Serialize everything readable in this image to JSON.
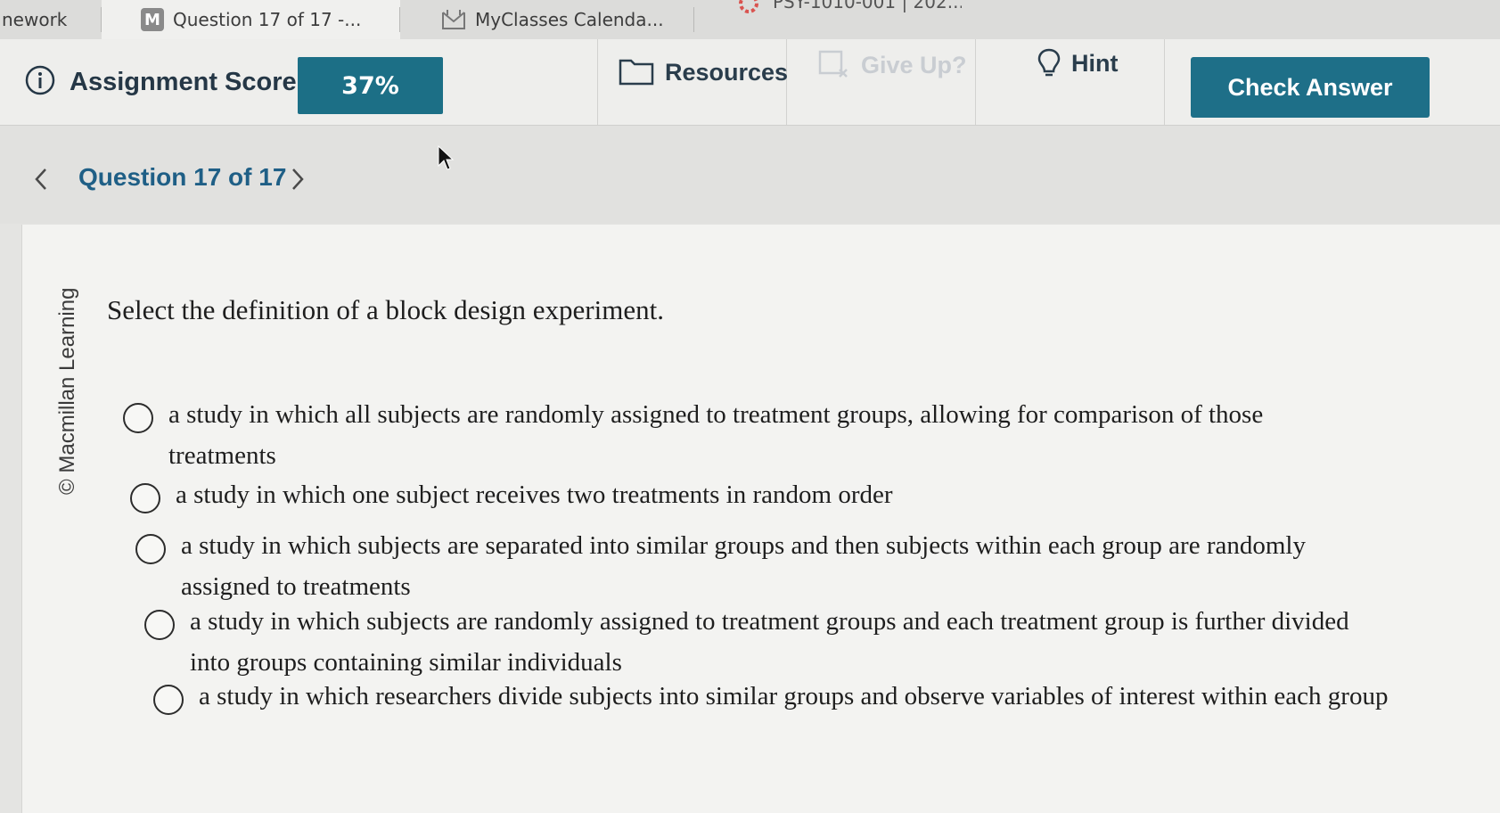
{
  "browser_tabs": [
    {
      "label": "nework"
    },
    {
      "icon": "M",
      "label": "Question 17 of 17 -..."
    },
    {
      "label": "MyClasses Calenda..."
    },
    {
      "label": "PSY-1010-001 | 202..."
    }
  ],
  "toolbar": {
    "score_label": "Assignment Score:",
    "score_value": "37%",
    "resources_label": "Resources",
    "give_up_label": "Give Up?",
    "hint_label": "Hint",
    "check_answer_label": "Check Answer"
  },
  "question_nav": {
    "label": "Question 17 of 17"
  },
  "content": {
    "credit": "© Macmillan Learning",
    "prompt": "Select the definition of a block design experiment.",
    "options": [
      "a study in which all subjects are randomly assigned to treatment groups, allowing for comparison of those treatments",
      "a study in which one subject receives two treatments in random order",
      "a study in which subjects are separated into similar groups and then subjects within each group are randomly assigned to treatments",
      "a study in which subjects are randomly assigned to treatment groups and each treatment group is further divided into groups containing similar individuals",
      "a study in which researchers divide subjects into similar groups and observe variables of interest within each group"
    ]
  },
  "colors": {
    "accent": "#1c6f86",
    "nav_text": "#1f5f86"
  }
}
